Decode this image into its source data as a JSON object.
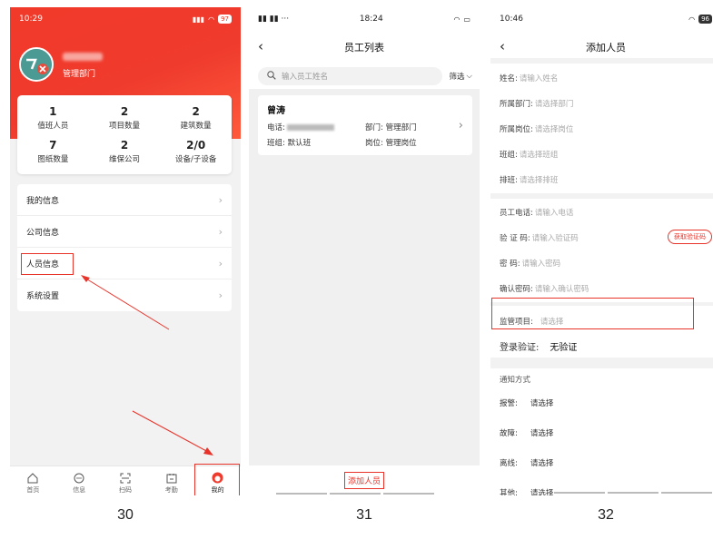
{
  "screen1": {
    "status": {
      "time": "10:29",
      "battery": "97"
    },
    "dept": "管理部门",
    "stats": [
      {
        "num": "1",
        "label": "值班人员"
      },
      {
        "num": "2",
        "label": "项目数量"
      },
      {
        "num": "2",
        "label": "建筑数量"
      },
      {
        "num": "7",
        "label": "图纸数量"
      },
      {
        "num": "2",
        "label": "维保公司"
      },
      {
        "num": "2/0",
        "label": "设备/子设备"
      }
    ],
    "menu": [
      "我的信息",
      "公司信息",
      "人员信息",
      "系统设置"
    ],
    "tabs": [
      "首页",
      "信息",
      "扫码",
      "考勤",
      "我的"
    ],
    "caption": "30"
  },
  "screen2": {
    "status": {
      "time": "18:24"
    },
    "title": "员工列表",
    "search_placeholder": "输入员工姓名",
    "filter": "筛选",
    "employee": {
      "name": "曾涛",
      "phone_label": "电话:",
      "dept_label": "部门:",
      "dept": "管理部门",
      "team_label": "班组:",
      "team": "默认班",
      "post_label": "岗位:",
      "post": "管理岗位"
    },
    "add_button": "添加人员",
    "caption": "31"
  },
  "screen3": {
    "status": {
      "time": "10:46",
      "battery": "96"
    },
    "title": "添加人员",
    "group1": [
      {
        "label": "姓名:",
        "placeholder": "请输入姓名"
      },
      {
        "label": "所属部门:",
        "placeholder": "请选择部门"
      },
      {
        "label": "所属岗位:",
        "placeholder": "请选择岗位"
      },
      {
        "label": "班组:",
        "placeholder": "请选择班组"
      },
      {
        "label": "排班:",
        "placeholder": "请选择排班"
      }
    ],
    "group2": [
      {
        "label": "员工电话:",
        "placeholder": "请输入电话"
      },
      {
        "label": "验 证 码:",
        "placeholder": "请输入验证码"
      },
      {
        "label": "密 码:",
        "placeholder": "请输入密码"
      },
      {
        "label": "确认密码:",
        "placeholder": "请输入确认密码"
      }
    ],
    "get_code": "获取验证码",
    "supervise": {
      "label": "监管项目:",
      "placeholder": "请选择"
    },
    "login": {
      "label": "登录验证:",
      "value": "无验证"
    },
    "notify_title": "通知方式",
    "notify": [
      {
        "label": "报警:",
        "value": "请选择"
      },
      {
        "label": "故障:",
        "value": "请选择"
      },
      {
        "label": "离线:",
        "value": "请选择"
      },
      {
        "label": "其他:",
        "value": "请选择"
      }
    ],
    "caption": "32"
  },
  "colors": {
    "brand_red": "#ef3b2d",
    "highlight": "#e8332a"
  }
}
